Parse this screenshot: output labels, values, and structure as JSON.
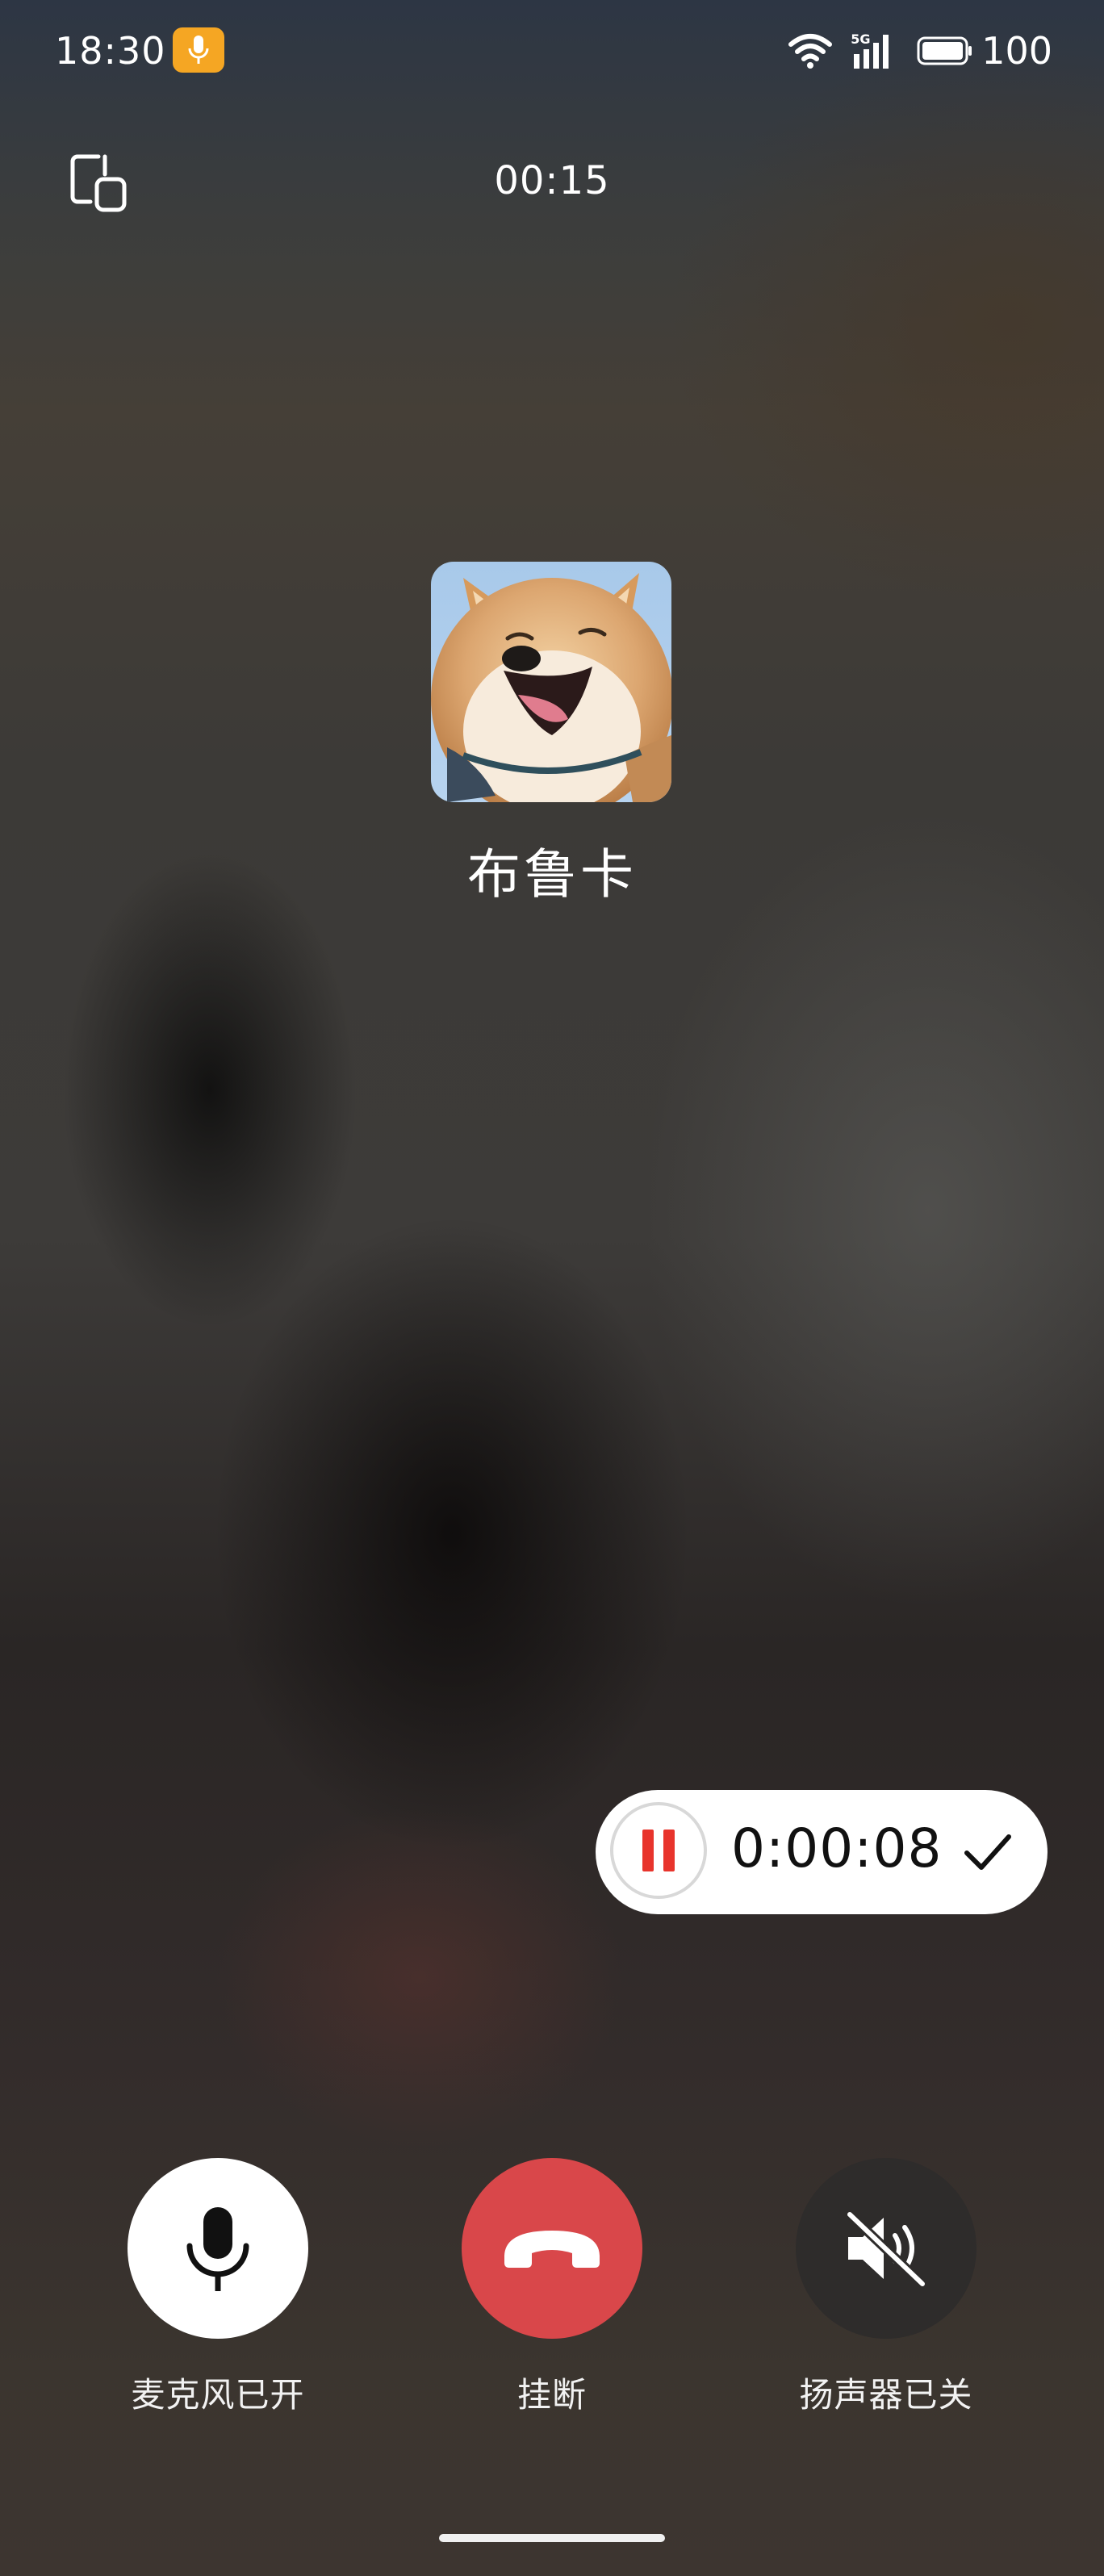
{
  "status_bar": {
    "time": "18:30",
    "network": "5G",
    "battery_level": "100"
  },
  "call": {
    "timer": "00:15",
    "contact_name": "布鲁卡"
  },
  "recording": {
    "elapsed": "0:00:08"
  },
  "controls": {
    "mic_label": "麦克风已开",
    "hangup_label": "挂断",
    "speaker_label": "扬声器已关"
  },
  "colors": {
    "hangup": "#d9474a",
    "mic_badge": "#f5a623",
    "pause_red": "#e8342c"
  },
  "icons": {
    "switch": "screen-switch-icon",
    "pause": "pause-icon",
    "done": "check-icon",
    "mic": "microphone-icon",
    "hangup": "phone-hangup-icon",
    "speaker": "speaker-muted-icon"
  }
}
